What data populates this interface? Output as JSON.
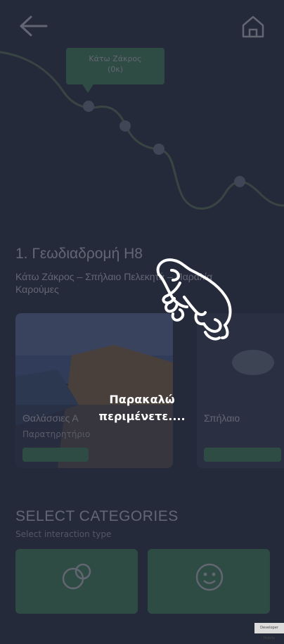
{
  "header": {
    "back_icon": "arrow-left-icon",
    "home_icon": "home-icon"
  },
  "map": {
    "tooltip_text": "Κάτω Ζάκρος\n(0κ)",
    "line_color": "#6a8c5a",
    "marker_color": "#8a8f9b"
  },
  "route": {
    "title": "1. Γεωδιαδρομή Η8",
    "subtitle": "Κάτω Ζάκρος – Σπήλαιο Πελεκητά – Παραλία Καρούμες"
  },
  "cards": [
    {
      "title": "Θαλάσσιες Α",
      "category": "Παρατηρητήριο",
      "button": ""
    },
    {
      "title": "Σπήλαιο",
      "category": "",
      "button": ""
    }
  ],
  "categories": {
    "title": "SELECT CATEGORIES",
    "subtitle": "Select interaction type",
    "items": [
      {
        "label": "",
        "icon": "tree-icon"
      },
      {
        "label": "",
        "icon": "face-icon"
      }
    ]
  },
  "loader": {
    "icon": "frog-icon",
    "text": "Παρακαλώ\nπεριμένετε...."
  },
  "watermark": "Developer Mobile",
  "colors": {
    "background": "#252a3b",
    "accent": "#47a35a"
  }
}
